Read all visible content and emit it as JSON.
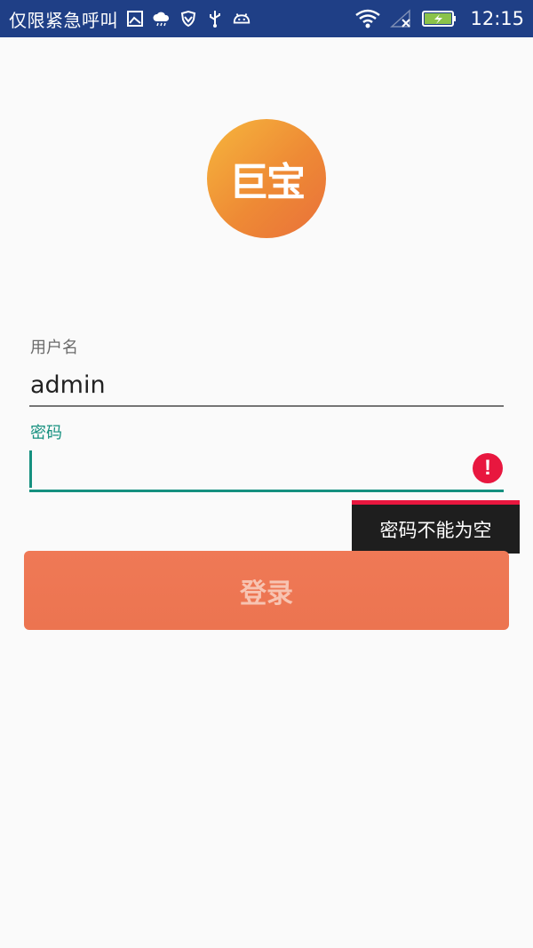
{
  "status_bar": {
    "carrier_text": "仅限紧急呼叫",
    "time": "12:15",
    "icons": [
      "image-icon",
      "cloud-icon",
      "vpn-shield-icon",
      "usb-icon",
      "android-icon",
      "wifi-icon",
      "no-signal-icon",
      "battery-charging-icon"
    ]
  },
  "logo": {
    "text": "巨宝"
  },
  "form": {
    "username": {
      "label": "用户名",
      "value": "admin"
    },
    "password": {
      "label": "密码",
      "value": "",
      "error_message": "密码不能为空"
    },
    "login_button_label": "登录"
  },
  "colors": {
    "status_bar": "#1f3f86",
    "accent": "#15907f",
    "error": "#e8173f",
    "button": "#ee7752"
  }
}
